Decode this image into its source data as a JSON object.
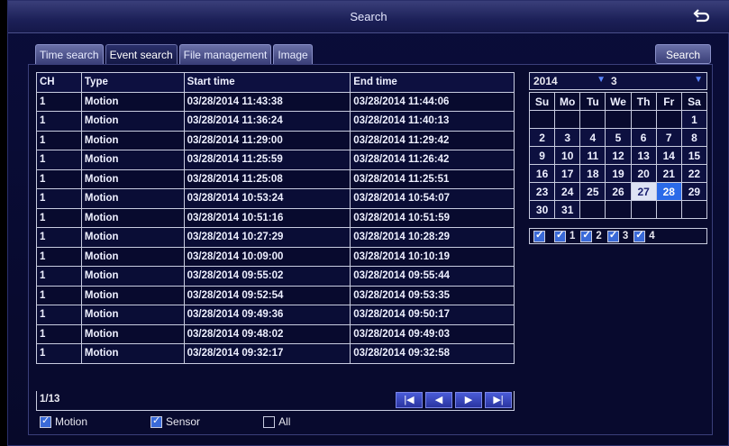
{
  "title": "Search",
  "tabs": [
    {
      "label": "Time search"
    },
    {
      "label": "Event search"
    },
    {
      "label": "File management"
    },
    {
      "label": "Image"
    }
  ],
  "search_button": "Search",
  "table": {
    "headers": [
      "CH",
      "Type",
      "Start time",
      "End time"
    ],
    "rows": [
      [
        "1",
        "Motion",
        "03/28/2014 11:43:38",
        "03/28/2014 11:44:06"
      ],
      [
        "1",
        "Motion",
        "03/28/2014 11:36:24",
        "03/28/2014 11:40:13"
      ],
      [
        "1",
        "Motion",
        "03/28/2014 11:29:00",
        "03/28/2014 11:29:42"
      ],
      [
        "1",
        "Motion",
        "03/28/2014 11:25:59",
        "03/28/2014 11:26:42"
      ],
      [
        "1",
        "Motion",
        "03/28/2014 11:25:08",
        "03/28/2014 11:25:51"
      ],
      [
        "1",
        "Motion",
        "03/28/2014 10:53:24",
        "03/28/2014 10:54:07"
      ],
      [
        "1",
        "Motion",
        "03/28/2014 10:51:16",
        "03/28/2014 10:51:59"
      ],
      [
        "1",
        "Motion",
        "03/28/2014 10:27:29",
        "03/28/2014 10:28:29"
      ],
      [
        "1",
        "Motion",
        "03/28/2014 10:09:00",
        "03/28/2014 10:10:19"
      ],
      [
        "1",
        "Motion",
        "03/28/2014 09:55:02",
        "03/28/2014 09:55:44"
      ],
      [
        "1",
        "Motion",
        "03/28/2014 09:52:54",
        "03/28/2014 09:53:35"
      ],
      [
        "1",
        "Motion",
        "03/28/2014 09:49:36",
        "03/28/2014 09:50:17"
      ],
      [
        "1",
        "Motion",
        "03/28/2014 09:48:02",
        "03/28/2014 09:49:03"
      ],
      [
        "1",
        "Motion",
        "03/28/2014 09:32:17",
        "03/28/2014 09:32:58"
      ]
    ]
  },
  "page_info": "1/13",
  "pager": {
    "first": "|◀",
    "prev": "◀",
    "next": "▶",
    "last": "▶|"
  },
  "filters": {
    "motion": {
      "label": "Motion",
      "checked": true
    },
    "sensor": {
      "label": "Sensor",
      "checked": true
    },
    "all": {
      "label": "All",
      "checked": false
    }
  },
  "calendar": {
    "year": "2014",
    "month": "3",
    "weekdays": [
      "Su",
      "Mo",
      "Tu",
      "We",
      "Th",
      "Fr",
      "Sa"
    ],
    "weeks": [
      [
        "",
        "",
        "",
        "",
        "",
        "",
        "1"
      ],
      [
        "2",
        "3",
        "4",
        "5",
        "6",
        "7",
        "8"
      ],
      [
        "9",
        "10",
        "11",
        "12",
        "13",
        "14",
        "15"
      ],
      [
        "16",
        "17",
        "18",
        "19",
        "20",
        "21",
        "22"
      ],
      [
        "23",
        "24",
        "25",
        "26",
        "27",
        "28",
        "29"
      ],
      [
        "30",
        "31",
        "",
        "",
        "",
        "",
        ""
      ]
    ],
    "today": "27",
    "selected": "28"
  },
  "channels": [
    {
      "label": "",
      "checked": true
    },
    {
      "label": "1",
      "checked": true
    },
    {
      "label": "2",
      "checked": true
    },
    {
      "label": "3",
      "checked": true
    },
    {
      "label": "4",
      "checked": true
    }
  ]
}
